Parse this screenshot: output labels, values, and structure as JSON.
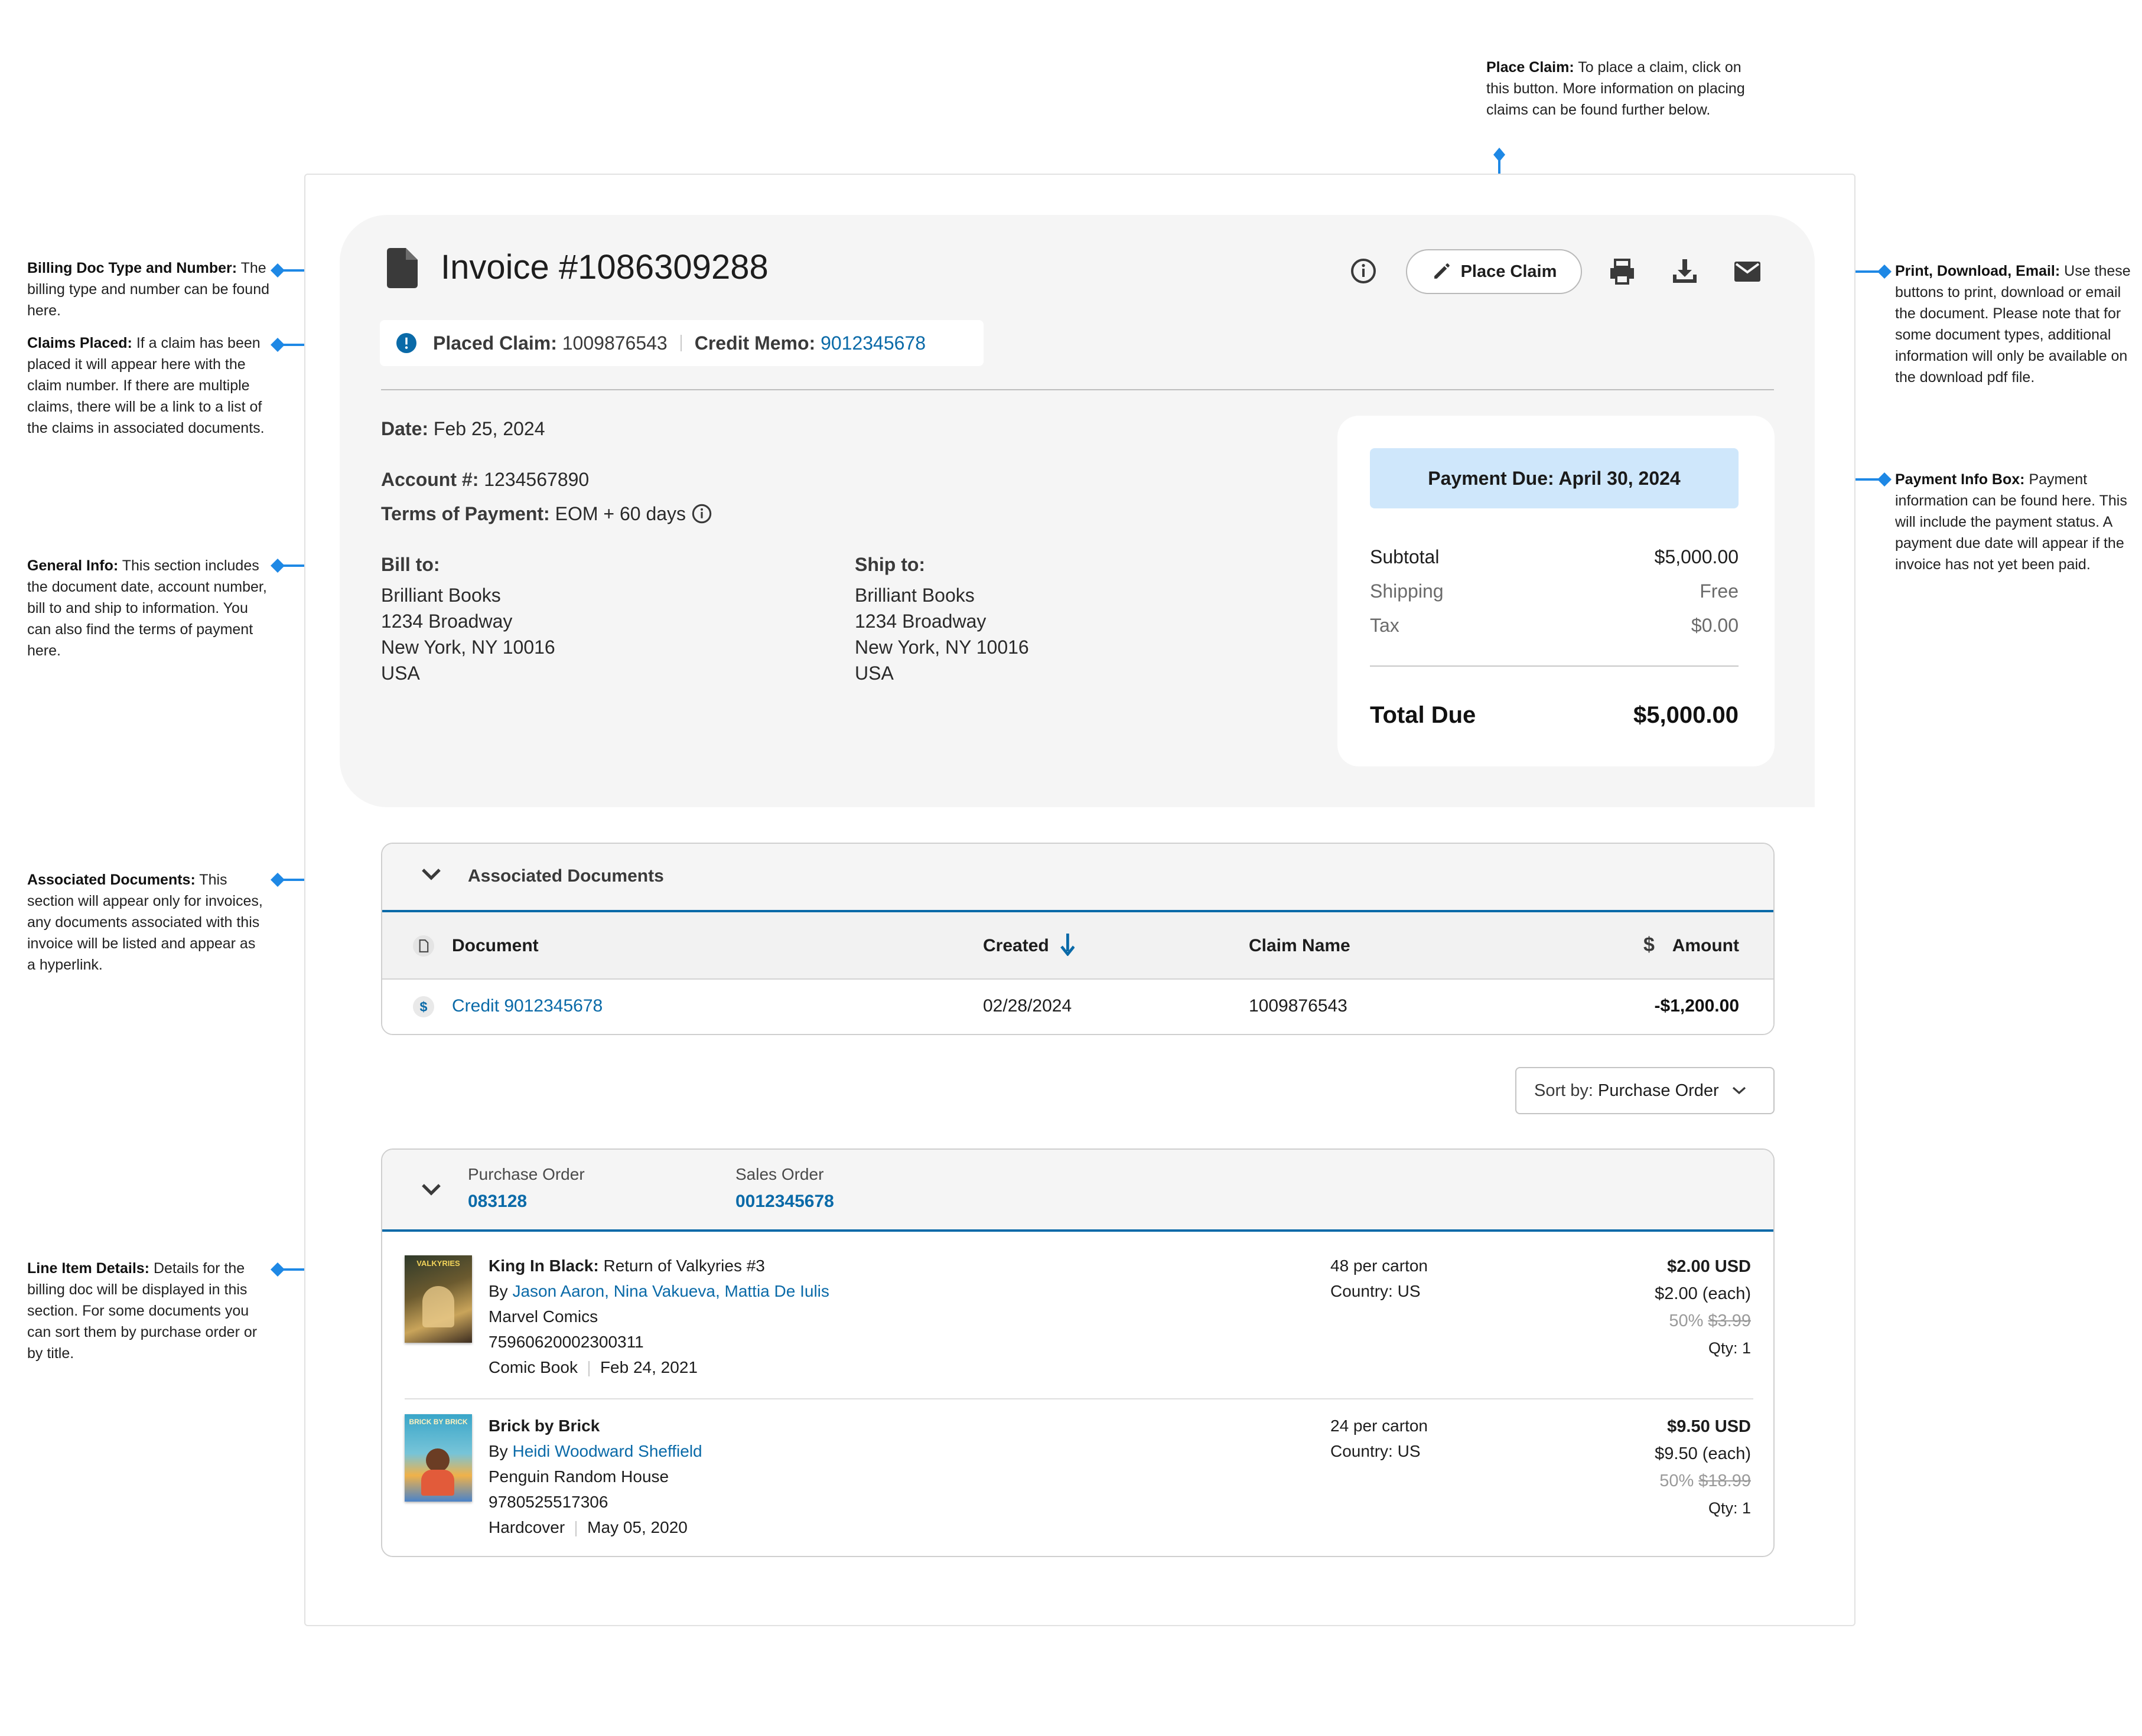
{
  "annotations": {
    "place_claim": {
      "title": "Place Claim:",
      "text": "To place a claim, click on this button. More information on placing claims can be found further below."
    },
    "billing_doc": {
      "title": "Billing Doc Type and Number:",
      "text": "The billing type and number can be found here."
    },
    "claims_placed": {
      "title": "Claims Placed:",
      "text": "If a claim has been placed it will appear here with the claim number. If there are multiple claims, there will be a link to a list of the claims in associated documents."
    },
    "general_info": {
      "title": "General Info:",
      "text": "This section includes the document date, account number, bill to and ship to information. You can also find the terms of payment here."
    },
    "associated_docs": {
      "title": "Associated Documents:",
      "text": "This section will appear only for invoices, any documents associated with this invoice will be listed and appear as a hyperlink."
    },
    "line_items": {
      "title": "Line Item Details:",
      "text": "Details for the billing doc will be displayed in this section. For some documents you can sort them by purchase order or by title."
    },
    "print_download": {
      "title": "Print, Download, Email:",
      "text": "Use these buttons to print, download or email the document. Please note that for some document types, additional information will only be available on the download pdf file."
    },
    "payment_info": {
      "title": "Payment Info Box:",
      "text": "Payment information can be found here. This will include the payment status. A payment due date will appear if the invoice has not yet been paid."
    }
  },
  "header": {
    "title": "Invoice #1086309288",
    "place_claim_label": "Place Claim"
  },
  "claims_bar": {
    "placed_claim_label": "Placed Claim:",
    "placed_claim_value": "1009876543",
    "credit_memo_label": "Credit Memo:",
    "credit_memo_value": "9012345678"
  },
  "general": {
    "date_label": "Date:",
    "date_value": "Feb 25, 2024",
    "account_label": "Account #:",
    "account_value": "1234567890",
    "terms_label": "Terms of Payment:",
    "terms_value": "EOM + 60 days",
    "bill_to": {
      "label": "Bill to:",
      "lines": [
        "Brilliant Books",
        "1234 Broadway",
        "New York, NY 10016",
        "USA"
      ]
    },
    "ship_to": {
      "label": "Ship to:",
      "lines": [
        "Brilliant Books",
        "1234 Broadway",
        "New York, NY 10016",
        "USA"
      ]
    }
  },
  "payment": {
    "due_label": "Payment Due: April 30, 2024",
    "subtotal_label": "Subtotal",
    "subtotal_value": "$5,000.00",
    "shipping_label": "Shipping",
    "shipping_value": "Free",
    "tax_label": "Tax",
    "tax_value": "$0.00",
    "total_label": "Total Due",
    "total_value": "$5,000.00"
  },
  "associated": {
    "title": "Associated Documents",
    "columns": {
      "document": "Document",
      "created": "Created",
      "claim_name": "Claim Name",
      "amount": "Amount"
    },
    "rows": [
      {
        "document": "Credit 9012345678",
        "created": "02/28/2024",
        "claim_name": "1009876543",
        "amount": "-$1,200.00"
      }
    ]
  },
  "sort": {
    "label": "Sort by:",
    "value": "Purchase Order"
  },
  "order_group": {
    "po_label": "Purchase Order",
    "po_value": "083128",
    "so_label": "Sales Order",
    "so_value": "0012345678"
  },
  "line_items": [
    {
      "title_bold": "King In Black:",
      "title_rest": " Return of Valkyries #3",
      "by": "By",
      "authors": "Jason Aaron, Nina Vakueva, Mattia De Iulis",
      "publisher": "Marvel Comics",
      "isbn": "75960620002300311",
      "format": "Comic Book",
      "date": "Feb 24, 2021",
      "carton": "48 per carton",
      "country": "Country: US",
      "price": "$2.00 USD",
      "each": "$2.00 (each)",
      "discount": "50%",
      "list_price": "$3.99",
      "qty": "Qty: 1",
      "cover_text": "VALKYRIES"
    },
    {
      "title_bold": "Brick by Brick",
      "title_rest": "",
      "by": "By",
      "authors": "Heidi Woodward Sheffield",
      "publisher": "Penguin Random House",
      "isbn": "9780525517306",
      "format": "Hardcover",
      "date": "May 05, 2020",
      "carton": "24 per carton",
      "country": "Country: US",
      "price": "$9.50 USD",
      "each": "$9.50 (each)",
      "discount": "50%",
      "list_price": "$18.99",
      "qty": "Qty: 1",
      "cover_text": "BRICK BY BRICK"
    }
  ],
  "colors": {
    "accent": "#0a6aa8",
    "annotation_blue": "#1e88e5",
    "payment_due_bg": "#cfe7fb",
    "panel_bg": "#f5f5f5"
  },
  "icons": [
    "document-icon",
    "info-icon",
    "pencil-icon",
    "print-icon",
    "download-icon",
    "email-icon",
    "alert-icon",
    "chevron-down-icon",
    "sort-arrow-icon",
    "dollar-icon"
  ]
}
